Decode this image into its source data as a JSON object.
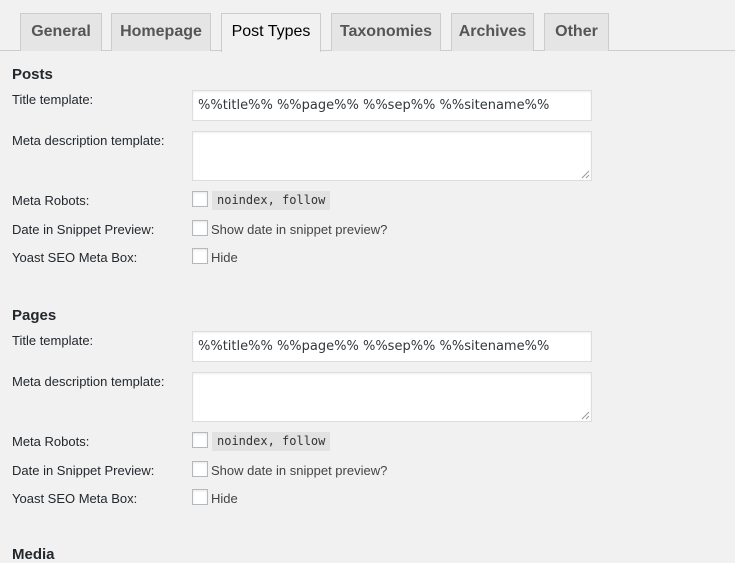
{
  "tabs": [
    {
      "label": "General",
      "active": false
    },
    {
      "label": "Homepage",
      "active": false
    },
    {
      "label": "Post Types",
      "active": true
    },
    {
      "label": "Taxonomies",
      "active": false
    },
    {
      "label": "Archives",
      "active": false
    },
    {
      "label": "Other",
      "active": false
    }
  ],
  "sections": [
    {
      "title": "Posts",
      "title_template_label": "Title template:",
      "title_template_value": "%%title%% %%page%% %%sep%% %%sitename%%",
      "meta_description_label": "Meta description template:",
      "meta_description_value": "",
      "meta_robots_label": "Meta Robots:",
      "meta_robots_value": "noindex, follow",
      "date_snippet_label": "Date in Snippet Preview:",
      "date_snippet_text": "Show date in snippet preview?",
      "metabox_label": "Yoast SEO Meta Box:",
      "metabox_text": "Hide"
    },
    {
      "title": "Pages",
      "title_template_label": "Title template:",
      "title_template_value": "%%title%% %%page%% %%sep%% %%sitename%%",
      "meta_description_label": "Meta description template:",
      "meta_description_value": "",
      "meta_robots_label": "Meta Robots:",
      "meta_robots_value": "noindex, follow",
      "date_snippet_label": "Date in Snippet Preview:",
      "date_snippet_text": "Show date in snippet preview?",
      "metabox_label": "Yoast SEO Meta Box:",
      "metabox_text": "Hide"
    }
  ],
  "next_section_title": "Media"
}
